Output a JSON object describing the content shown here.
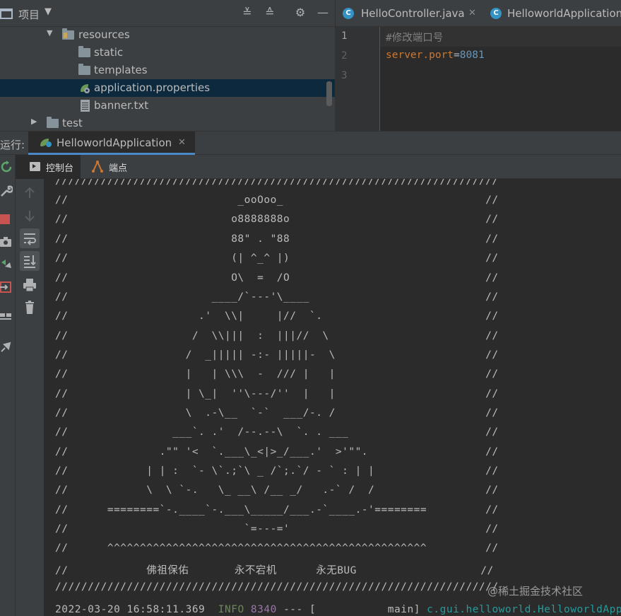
{
  "project": {
    "title": "项目",
    "tree": [
      {
        "label": "resources",
        "expanded": true
      },
      {
        "label": "static"
      },
      {
        "label": "templates"
      },
      {
        "label": "application.properties",
        "selected": true
      },
      {
        "label": "banner.txt"
      },
      {
        "label": "test",
        "expanded": false
      }
    ]
  },
  "editor": {
    "tabs": [
      {
        "label": "HelloController.java"
      },
      {
        "label": "HelloworldApplication"
      }
    ],
    "line_numbers": [
      "1",
      "2",
      "3"
    ],
    "code": {
      "comment": "#修改端口号",
      "key": "server.port",
      "eq": "=",
      "value": "8081"
    }
  },
  "run": {
    "label": "运行:",
    "tab_label": "HelloworldApplication",
    "console_tab": "控制台",
    "endpoint_tab": "端点"
  },
  "console": {
    "lines": [
      "////////////////////////////////////////////////////////////////////",
      "//                          _ooOoo_                               //",
      "//                         o8888888o                              //",
      "//                         88\" . \"88                              //",
      "//                         (| ^_^ |)                              //",
      "//                         O\\  =  /O                              //",
      "//                      ____/`---'\\____                           //",
      "//                    .'  \\\\|     |//  `.                         //",
      "//                   /  \\\\|||  :  |||//  \\                        //",
      "//                  /  _||||| -:- |||||-  \\                       //",
      "//                  |   | \\\\\\  -  /// |   |                       //",
      "//                  | \\_|  ''\\---/''  |   |                       //",
      "//                  \\  .-\\__  `-`  ___/-. /                       //",
      "//                ___`. .'  /--.--\\  `. . ___                     //",
      "//              .\"\" '<  `.___\\_<|>_/___.'  >'\"\".                  //",
      "//            | | :  `- \\`.;`\\ _ /`;.`/ - ` : | |                 //",
      "//            \\  \\ `-.   \\_ __\\ /__ _/   .-` /  /                 //",
      "//      ========`-.____`-.___\\_____/___.-`____.-'========         //",
      "//                           `=---='                              //",
      "//      ^^^^^^^^^^^^^^^^^^^^^^^^^^^^^^^^^^^^^^^^^^^^^^^^^         //",
      "//            佛祖保佑       永不宕机      永无BUG                   //",
      "////////////////////////////////////////////////////////////////////"
    ],
    "log": {
      "timestamp": "2022-03-20 16:58:11.369",
      "level": "INFO",
      "pid": "8340",
      "sep": "---",
      "thread": "[           main]",
      "logger": "c.gui.helloworld.HelloworldApplication"
    }
  },
  "watermark": "@稀土掘金技术社区",
  "colors": {
    "background": "#2b2b2b",
    "panel": "#3c3f41",
    "selection": "#0d293e",
    "accent": "#4a88c7",
    "keyword": "#cc7832",
    "number": "#6897bb"
  }
}
